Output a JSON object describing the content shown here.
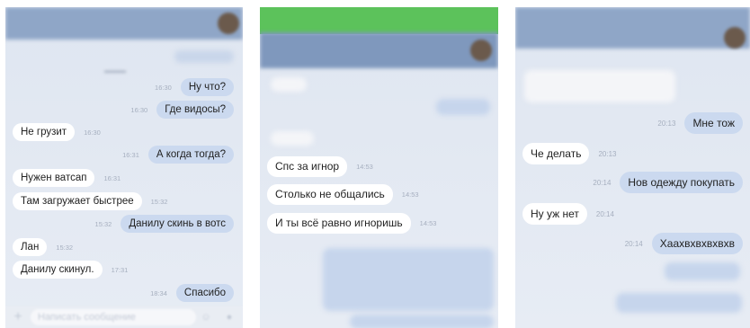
{
  "panel1": {
    "messages": [
      {
        "side": "out",
        "text": "Ну что?",
        "time": "16:30"
      },
      {
        "side": "out",
        "text": "Где видосы?",
        "time": "16:30"
      },
      {
        "side": "in",
        "text": "Не грузит",
        "time": "16:30"
      },
      {
        "side": "out",
        "text": "А когда тогда?",
        "time": "16:31"
      },
      {
        "side": "in",
        "text": "Нужен ватсап",
        "time": "16:31"
      },
      {
        "side": "in",
        "text": "Там загружает быстрее",
        "time": "15:32"
      },
      {
        "side": "out",
        "text": "Данилу скинь в вотс",
        "time": "15:32"
      },
      {
        "side": "in",
        "text": "Лан",
        "time": "15:32"
      },
      {
        "side": "in",
        "text": "Данилу скинул.",
        "time": "17:31"
      },
      {
        "side": "out",
        "text": "Спасибо",
        "time": "18:34"
      }
    ],
    "composer_placeholder": "Написать сообщение"
  },
  "panel2": {
    "messages": [
      {
        "side": "in",
        "text": "Спс за игнор",
        "time": "14:53"
      },
      {
        "side": "in",
        "text": "Столько не общались",
        "time": "14:53"
      },
      {
        "side": "in",
        "text": "И ты всё равно игноришь",
        "time": "14:53"
      }
    ]
  },
  "panel3": {
    "messages": [
      {
        "side": "out",
        "text": "Мне тож",
        "time": "20:13"
      },
      {
        "side": "in",
        "text": "Че делать",
        "time": "20:13"
      },
      {
        "side": "out",
        "text": "Нов одежду покупать",
        "time": "20:14"
      },
      {
        "side": "in",
        "text": "Ну уж нет",
        "time": "20:14"
      },
      {
        "side": "out",
        "text": "Хаахвхвхвхвхв",
        "time": "20:14"
      }
    ]
  },
  "colors": {
    "incoming_bubble": "#ffffff",
    "outgoing_bubble": "#cbd9ef",
    "status_bar_green": "#5cc25b"
  }
}
